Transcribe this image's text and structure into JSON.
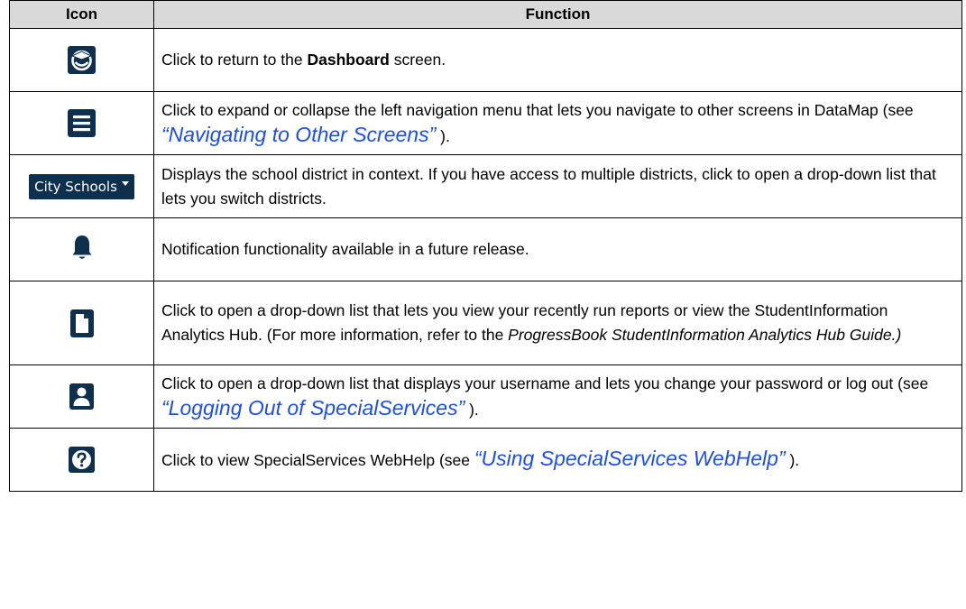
{
  "header": {
    "icon": "Icon",
    "function": "Function"
  },
  "rows": [
    {
      "icon": "dashboard-logo-icon",
      "parts": [
        "Click to return to the ",
        "Dashboard",
        " screen."
      ]
    },
    {
      "icon": "hamburger-menu-icon",
      "parts": [
        "Click to expand or collapse the left navigation menu that lets you navigate to other screens in DataMap (see ",
        "“Navigating to Other Screens”",
        " )."
      ]
    },
    {
      "icon": "district-dropdown",
      "district_label": "City Schools",
      "parts": [
        "Displays the school district in context. If you have access to multiple districts, click to open a drop-down list that lets you switch districts."
      ]
    },
    {
      "icon": "bell-icon",
      "parts": [
        "Notification functionality available in a future release."
      ]
    },
    {
      "icon": "document-icon",
      "parts": [
        "Click to open a drop-down list that lets you view your recently run reports or view the StudentInformation Analytics Hub. (For more information, refer to the ",
        "ProgressBook StudentInformation Analytics Hub Guide.)"
      ]
    },
    {
      "icon": "user-icon",
      "parts": [
        "Click to open a drop-down list that displays your username and lets you change your password or log out (see ",
        "“Logging Out of SpecialServices”",
        " )."
      ]
    },
    {
      "icon": "help-question-icon",
      "parts": [
        "Click to view SpecialServices WebHelp (see ",
        "“Using SpecialServices WebHelp”",
        " )."
      ]
    }
  ],
  "colors": {
    "icon_bg": "#0f2f4e",
    "link": "#1f4fe0",
    "header_bg": "#d9d9d9"
  }
}
